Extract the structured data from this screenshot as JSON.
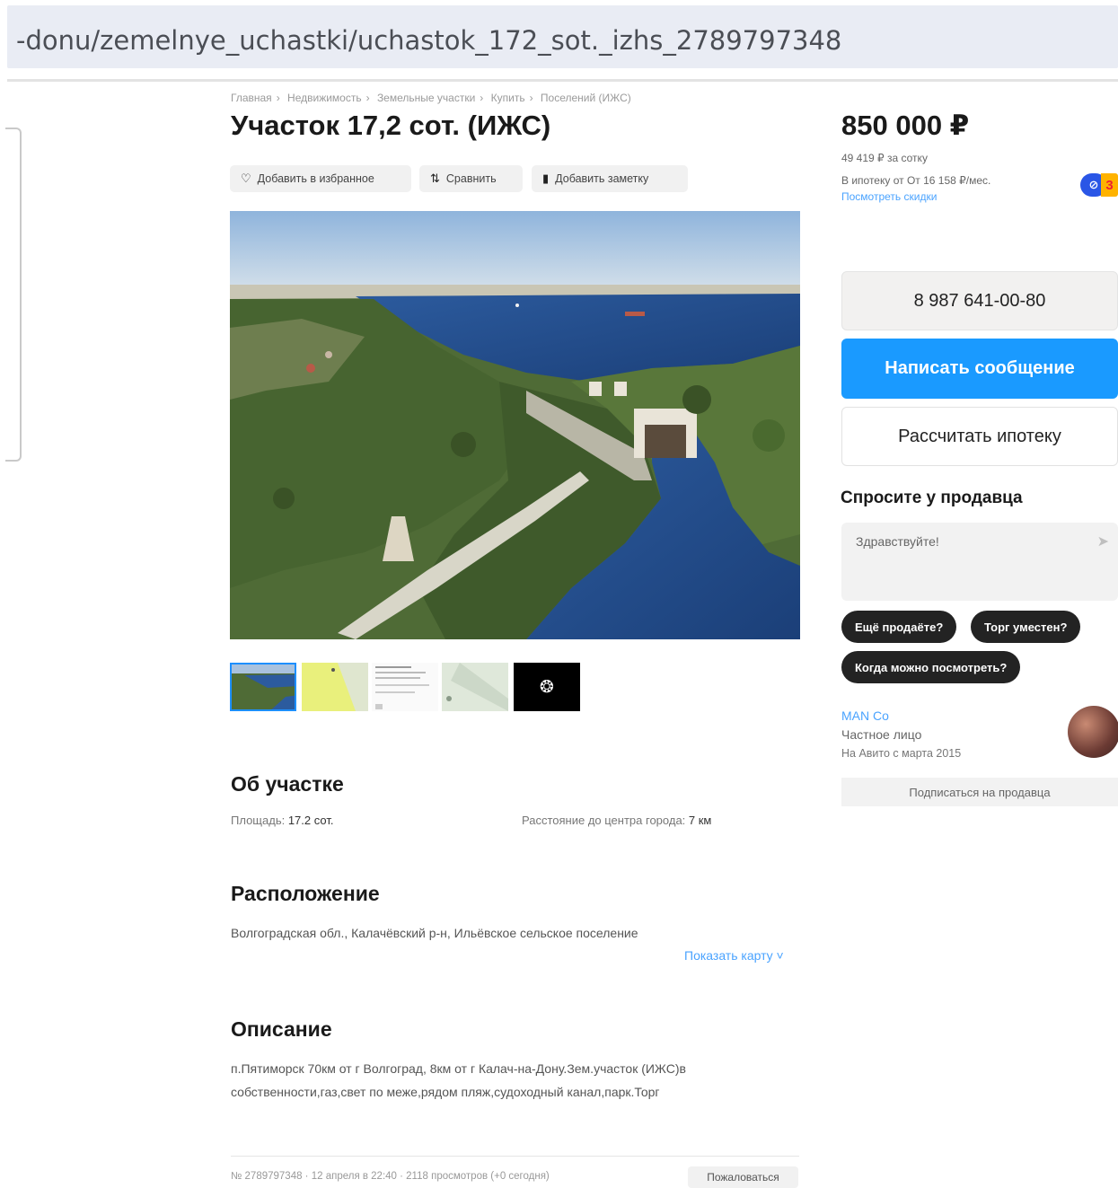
{
  "browser": {
    "url": "-donu/zemelnye_uchastki/uchastok_172_sot._izhs_2789797348"
  },
  "breadcrumbs": [
    "Главная",
    "Недвижимость",
    "Земельные участки",
    "Купить",
    "Поселений (ИЖС)"
  ],
  "listing": {
    "title": "Участок 17,2 сот. (ИЖС)",
    "actions": {
      "favorite": "Добавить в избранное",
      "compare": "Сравнить",
      "note": "Добавить заметку"
    }
  },
  "about": {
    "heading": "Об участке",
    "area_label": "Площадь:",
    "area_value": "17.2 сот.",
    "distance_label": "Расстояние до центра города:",
    "distance_value": "7 км"
  },
  "location": {
    "heading": "Расположение",
    "address": "Волгоградская обл., Калачёвский р-н, Ильёвское сельское поселение",
    "map_link": "Показать карту ˅"
  },
  "description": {
    "heading": "Описание",
    "text": "п.Пятиморск 70км от г Волгоград, 8км от г Калач-на-Дону.Зем.участок (ИЖС)в собственности,газ,свет по меже,рядом пляж,судоходный канал,парк.Торг"
  },
  "footer": {
    "meta": "№ 2789797348 · 12 апреля в 22:40 · 2118 просмотров (+0 сегодня)",
    "complain": "Пожаловаться"
  },
  "sidebar": {
    "price": "850 000 ₽",
    "price_per_hundred": "49 419 ₽ за сотку",
    "mortgage": "В ипотеку от От 16 158 ₽/мес.",
    "discount_link": "Посмотреть скидки",
    "bank_icon": "bank-logo-icon",
    "phone": "8 987 641-00-80",
    "write_message": "Написать сообщение",
    "calc_mortgage": "Рассчитать ипотеку",
    "ask_heading": "Спросите у продавца",
    "ask_placeholder": "Здравствуйте!",
    "quick_questions": [
      "Ещё продаёте?",
      "Торг уместен?",
      "Когда можно посмотреть?"
    ],
    "seller": {
      "name": "MAN Co",
      "type": "Частное лицо",
      "since": "На Авито с марта 2015"
    },
    "subscribe": "Подписаться на продавца"
  },
  "colors": {
    "accent": "#1a9aff",
    "link": "#4aa3ff",
    "chip": "#232323"
  }
}
